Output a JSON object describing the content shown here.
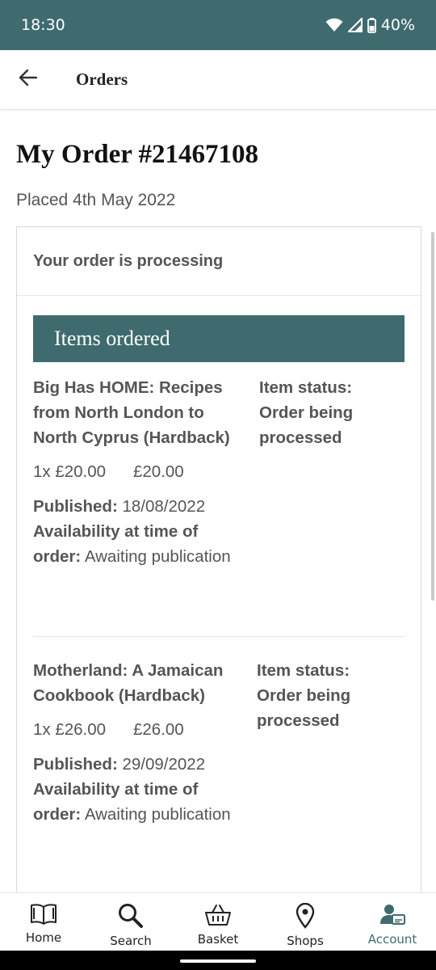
{
  "status_bar": {
    "time": "18:30",
    "battery": "40%"
  },
  "app_bar": {
    "title": "Orders"
  },
  "order": {
    "title": "My Order #21467108",
    "placed": "Placed 4th May 2022",
    "status": "Your order is processing",
    "items_header": "Items ordered",
    "items": [
      {
        "title": "Big Has HOME: Recipes from North London to North Cyprus (Hardback)",
        "status": "Item status: Order being processed",
        "qty_price": "1x £20.00",
        "total": "£20.00",
        "published_label": "Published:",
        "published_date": "18/08/2022",
        "availability_label": "Availability at time of order:",
        "availability_value": "Awaiting publication"
      },
      {
        "title": "Motherland: A Jamaican Cookbook (Hardback)",
        "status": "Item status: Order being processed",
        "qty_price": "1x £26.00",
        "total": "£26.00",
        "published_label": "Published:",
        "published_date": "29/09/2022",
        "availability_label": "Availability at time of order:",
        "availability_value": "Awaiting publication"
      }
    ]
  },
  "bottom_nav": {
    "items": [
      {
        "label": "Home",
        "icon": "book-icon"
      },
      {
        "label": "Search",
        "icon": "search-icon"
      },
      {
        "label": "Basket",
        "icon": "basket-icon"
      },
      {
        "label": "Shops",
        "icon": "location-pin-icon"
      },
      {
        "label": "Account",
        "icon": "account-icon"
      }
    ],
    "active": "Account"
  },
  "colors": {
    "brand": "#3f6b6f",
    "text": "#555555"
  }
}
